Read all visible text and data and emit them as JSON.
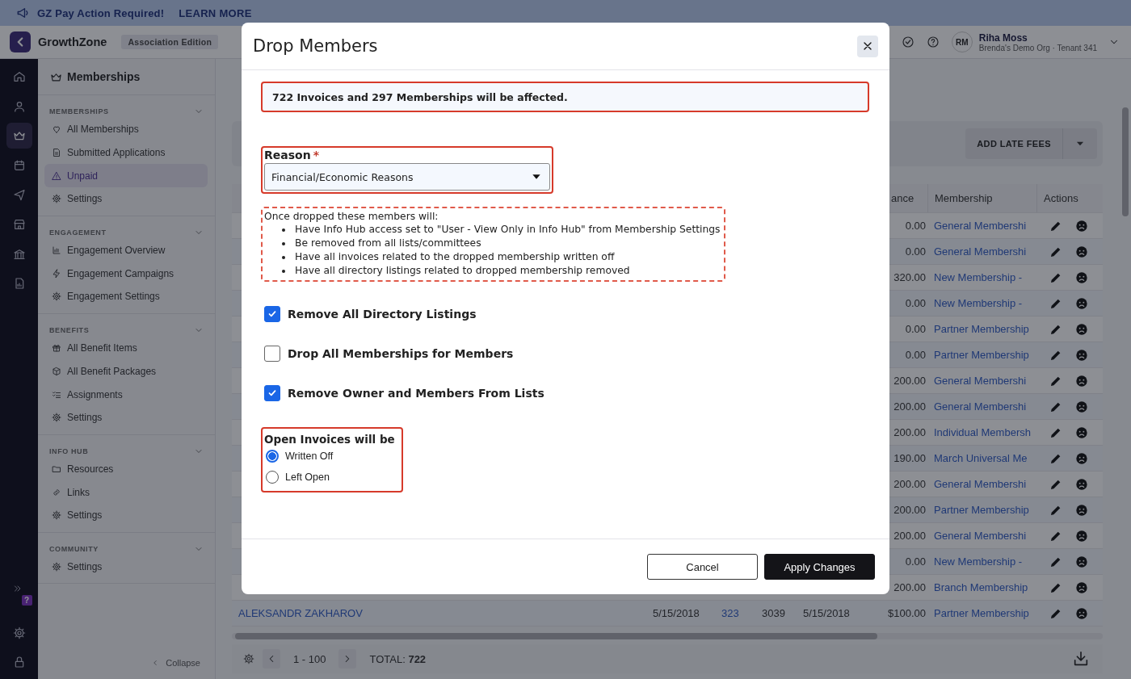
{
  "banner": {
    "text": "GZ Pay Action Required!",
    "link": "LEARN MORE"
  },
  "header": {
    "brand": "GrowthZone",
    "edition": "Association Edition",
    "user": {
      "initials": "RM",
      "name": "Riha Moss",
      "org": "Brenda's Demo Org · Tenant 341"
    }
  },
  "rail": {
    "items": [
      {
        "kind": "home",
        "selected": false
      },
      {
        "kind": "person",
        "selected": false
      },
      {
        "kind": "crown",
        "selected": true
      },
      {
        "kind": "calendar",
        "selected": false
      },
      {
        "kind": "send",
        "selected": false
      },
      {
        "kind": "store",
        "selected": false
      },
      {
        "kind": "bank",
        "selected": false
      },
      {
        "kind": "report",
        "selected": false
      }
    ],
    "help_badge": "?"
  },
  "sidebar": {
    "title": "Memberships",
    "sections": [
      {
        "heading": "MEMBERSHIPS",
        "expanded": true,
        "items": [
          {
            "label": "All Memberships",
            "kind": "heart",
            "selected": false
          },
          {
            "label": "Submitted Applications",
            "kind": "doc",
            "selected": false
          },
          {
            "label": "Unpaid",
            "kind": "warning",
            "selected": true
          },
          {
            "label": "Settings",
            "kind": "gear",
            "selected": false
          }
        ]
      },
      {
        "heading": "ENGAGEMENT",
        "expanded": true,
        "items": [
          {
            "label": "Engagement Overview",
            "kind": "chart",
            "selected": false
          },
          {
            "label": "Engagement Campaigns",
            "kind": "bolt",
            "selected": false
          },
          {
            "label": "Engagement Settings",
            "kind": "gear",
            "selected": false
          }
        ]
      },
      {
        "heading": "BENEFITS",
        "expanded": true,
        "items": [
          {
            "label": "All Benefit Items",
            "kind": "gift",
            "selected": false
          },
          {
            "label": "All Benefit Packages",
            "kind": "package",
            "selected": false
          },
          {
            "label": "Assignments",
            "kind": "checklist",
            "selected": false
          },
          {
            "label": "Settings",
            "kind": "gear",
            "selected": false
          }
        ]
      },
      {
        "heading": "INFO HUB",
        "expanded": true,
        "items": [
          {
            "label": "Resources",
            "kind": "folder",
            "selected": false
          },
          {
            "label": "Links",
            "kind": "link",
            "selected": false
          },
          {
            "label": "Settings",
            "kind": "gear",
            "selected": false
          }
        ]
      },
      {
        "heading": "COMMUNITY",
        "expanded": true,
        "items": [
          {
            "label": "Settings",
            "kind": "gear",
            "selected": false
          }
        ]
      }
    ],
    "collapse": "Collapse"
  },
  "page": {
    "toolbar": {
      "button": "ADD LATE FEES"
    }
  },
  "table": {
    "header": {
      "column_6": "ance",
      "column_7": "Membership",
      "column_8": "Actions"
    },
    "rows": [
      {
        "column_6": "0.00",
        "column_7": "General Membershi"
      },
      {
        "column_6": "0.00",
        "column_7": "General Membershi"
      },
      {
        "column_6": "320.00",
        "column_7": "New Membership -"
      },
      {
        "column_6": "0.00",
        "column_7": "New Membership -"
      },
      {
        "column_6": "0.00",
        "column_7": "Partner Membership"
      },
      {
        "column_6": "0.00",
        "column_7": "Partner Membership"
      },
      {
        "column_6": "200.00",
        "column_7": "General Membershi"
      },
      {
        "column_6": "200.00",
        "column_7": "General Membershi"
      },
      {
        "column_6": "200.00",
        "column_7": "Individual Membersh"
      },
      {
        "column_6": "190.00",
        "column_7": "March Universal Me"
      },
      {
        "column_6": "200.00",
        "column_7": "General Membershi"
      },
      {
        "column_6": "200.00",
        "column_7": "Partner Membership"
      },
      {
        "column_6": "200.00",
        "column_7": "General Membershi"
      },
      {
        "column_6": "0.00",
        "column_7": "New Membership -"
      },
      {
        "column_6": "200.00",
        "column_7": "Branch Membership"
      },
      {
        "column_1": "ALEKSANDR ZAKHAROV",
        "column_2": "5/15/2018",
        "column_3": "323",
        "column_4": "3039",
        "column_5": "5/15/2018",
        "column_6": "$100.00",
        "column_7": "Partner Membership"
      }
    ]
  },
  "pager": {
    "range": "1 - 100",
    "total": "TOTAL: **722**"
  },
  "modal": {
    "title": "Drop Members",
    "summary": "722 Invoices and 297 Memberships will be affected.",
    "reason": {
      "label": "Reason",
      "required_mark": "*",
      "value": "Financial/Economic Reasons"
    },
    "notice": {
      "intro": "Once dropped these members will:",
      "items": [
        "Have Info Hub access set to \"User - View Only in Info Hub\" from Membership Settings",
        "Be removed from all lists/committees",
        "Have all invoices related to the dropped membership written off",
        "Have all directory listings related to dropped membership removed"
      ]
    },
    "options": [
      {
        "label": "Remove All Directory Listings",
        "checked": true
      },
      {
        "label": "Drop All Memberships for Members",
        "checked": false
      },
      {
        "label": "Remove Owner and Members From Lists",
        "checked": true
      }
    ],
    "invoices": {
      "label": "Open Invoices will be",
      "choices": [
        {
          "label": "Written Off",
          "selected": true
        },
        {
          "label": "Left Open",
          "selected": false
        }
      ]
    },
    "buttons": [
      {
        "label": "Cancel",
        "kind": "secondary"
      },
      {
        "label": "Apply Changes",
        "kind": "primary"
      }
    ]
  }
}
